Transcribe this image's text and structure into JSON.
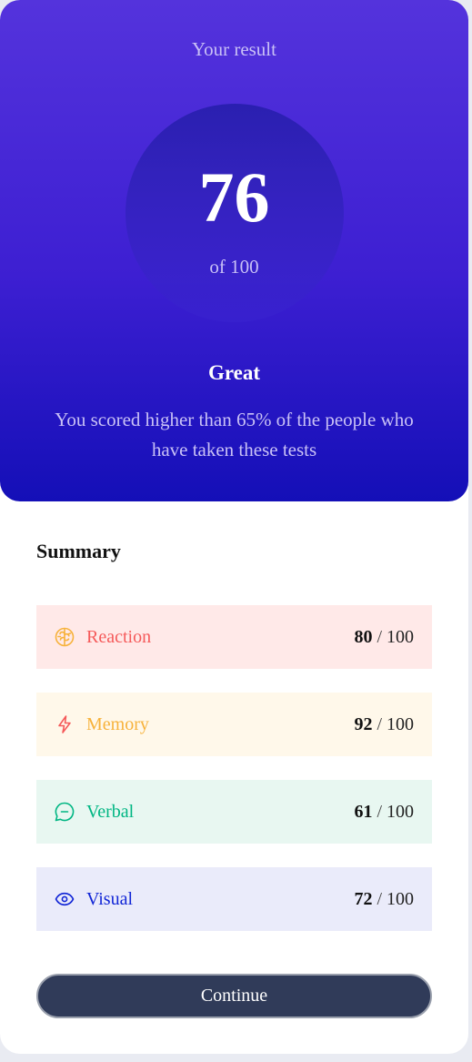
{
  "result": {
    "title": "Your result",
    "score": "76",
    "score_max": "of 100",
    "rating": "Great",
    "description": "You scored higher than 65% of the people who have taken these tests"
  },
  "summary": {
    "title": "Summary",
    "items": [
      {
        "label": "Reaction",
        "score": "80",
        "separator": "/",
        "total": "100",
        "icon": "brain-icon",
        "color": "#f55a5a",
        "icon_color": "#f7b23b",
        "bg": "#ffe9e8"
      },
      {
        "label": "Memory",
        "score": "92",
        "separator": "/",
        "total": "100",
        "icon": "lightning-icon",
        "color": "#f7b23b",
        "icon_color": "#f55a5a",
        "bg": "#fff8ea"
      },
      {
        "label": "Verbal",
        "score": "61",
        "separator": "/",
        "total": "100",
        "icon": "chat-bubble-icon",
        "color": "#00b683",
        "icon_color": "#00b683",
        "bg": "#e8f7f1"
      },
      {
        "label": "Visual",
        "score": "72",
        "separator": "/",
        "total": "100",
        "icon": "eye-icon",
        "color": "#1125d6",
        "icon_color": "#1125d6",
        "bg": "#eaebfa"
      }
    ]
  },
  "continue_label": "Continue"
}
